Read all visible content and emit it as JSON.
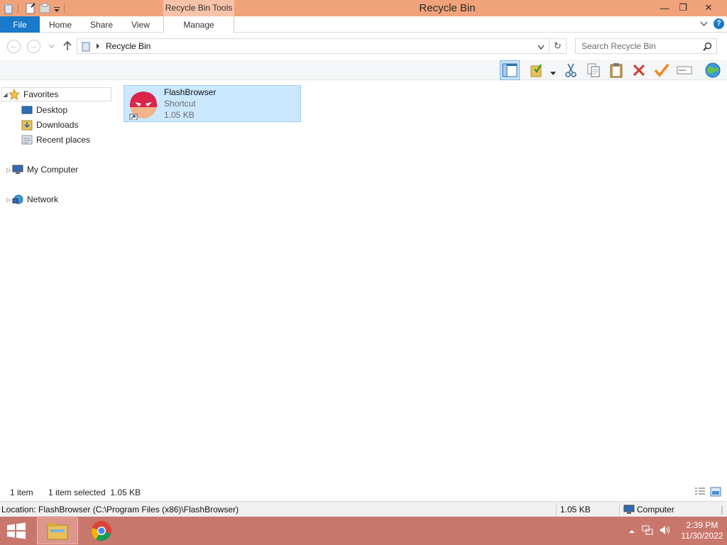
{
  "window": {
    "title": "Recycle Bin",
    "contextual_tab_group": "Recycle Bin Tools",
    "controls": {
      "minimize": "—",
      "maximize": "❐",
      "close": "✕"
    }
  },
  "ribbon": {
    "tabs": [
      "File",
      "Home",
      "Share",
      "View",
      "Manage"
    ],
    "help": "?"
  },
  "navigation": {
    "address_path": "Recycle Bin",
    "search_placeholder": "Search Recycle Bin"
  },
  "navpane": {
    "favorites": "Favorites",
    "favorites_items": [
      "Desktop",
      "Downloads",
      "Recent places"
    ],
    "my_computer": "My Computer",
    "network": "Network"
  },
  "content": {
    "items": [
      {
        "name": "FlashBrowser",
        "type": "Shortcut",
        "size": "1.05 KB"
      }
    ]
  },
  "statusbar": {
    "item_count": "1 item",
    "selection": "1 item selected  1.05 KB"
  },
  "details": {
    "location": "Location: FlashBrowser (C:\\Program Files (x86)\\FlashBrowser)",
    "size": "1.05 KB",
    "zone": "Computer"
  },
  "taskbar": {
    "time": "2:39 PM",
    "date": "11/30/2022"
  },
  "colors": {
    "titlebar": "#f0a27a",
    "file_tab": "#1979ca",
    "selection": "#cce8ff",
    "taskbar": "#c9776d"
  }
}
